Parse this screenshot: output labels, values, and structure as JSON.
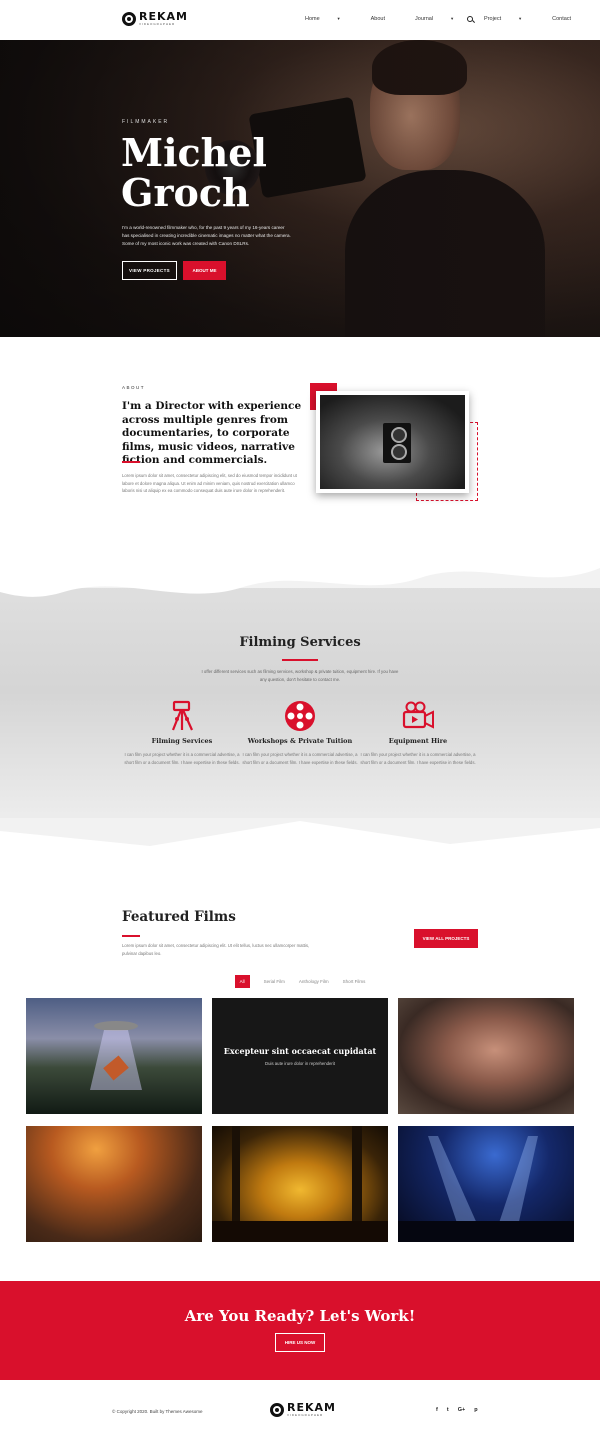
{
  "brand": {
    "name": "REKAM",
    "tagline": "VIDEOGRAPHER"
  },
  "nav": {
    "items": [
      {
        "label": "Home",
        "dropdown": true
      },
      {
        "label": "About",
        "dropdown": false
      },
      {
        "label": "Journal",
        "dropdown": true
      },
      {
        "label": "Project",
        "dropdown": true
      },
      {
        "label": "Contact",
        "dropdown": false
      }
    ],
    "search_icon": "search-icon"
  },
  "hero": {
    "kicker": "FILMMAKER",
    "title_line1": "Michel",
    "title_line2": "Groch",
    "description": "I'm a world-renowned filmmaker who, for the past 9 years of my 16-years career has specialised in creating incredible cinematic images no matter what the camera. Some of my most iconic work was created with Canon DSLRs.",
    "btn_projects": "VIEW PROJECTS",
    "btn_about": "ABOUT ME"
  },
  "about": {
    "kicker": "ABOUT",
    "heading": "I'm a Director with experience across multiple genres from documentaries, to corporate films, music videos, narrative fiction and commercials.",
    "description": "Lorem ipsum dolor sit amet, consectetur adipiscing elit, sed do eiusmod tempor incididunt ut labore et dolore magna aliqua. Ut enim ad minim veniam, quis nostrud exercitation ullamco laboris nisi ut aliquip ex ea commodo consequat duis aute irure dolor in reprehenderit."
  },
  "services": {
    "title": "Filming Services",
    "intro": "I offer different services such as filming services, workshop & private tuition, equipment hire. If you have any question, don't hesitate to contact me.",
    "items": [
      {
        "name": "Filming Services",
        "icon": "tripod-icon",
        "desc": "I can film your project whether it is a commercial advertise, a short film or a document film. I have expertise in these fields."
      },
      {
        "name": "Workshops & Private Tuition",
        "icon": "film-reel-icon",
        "desc": "I can film your project whether it is a commercial advertise, a short film or a document film. I have expertise in these fields."
      },
      {
        "name": "Equipment Hire",
        "icon": "video-camera-icon",
        "desc": "I can film your project whether it is a commercial advertise, a short film or a document film. I have expertise in these fields."
      }
    ]
  },
  "films": {
    "title": "Featured Films",
    "description": "Lorem ipsum dolor sit amet, consectetur adipiscing elit. Ut elit tellus, luctus nec ullamcorper mattis, pulvinar dapibus leo.",
    "view_all": "VIEW ALL PROJECTS",
    "filters": [
      "All",
      "Serial Film",
      "Anthology Film",
      "Short Films"
    ],
    "overlay_title": "Excepteur sint occaecat cupidatat",
    "overlay_sub": "Duis aute irure dolor in reprehenderit"
  },
  "cta": {
    "title": "Are You Ready? Let's Work!",
    "button": "HIRE US NOW"
  },
  "footer": {
    "copyright": "© Copyright 2020. Built by Themes Awesome",
    "socials": [
      "f",
      "t",
      "G+",
      "p"
    ]
  },
  "colors": {
    "accent": "#d9102c",
    "dark": "#111111"
  }
}
